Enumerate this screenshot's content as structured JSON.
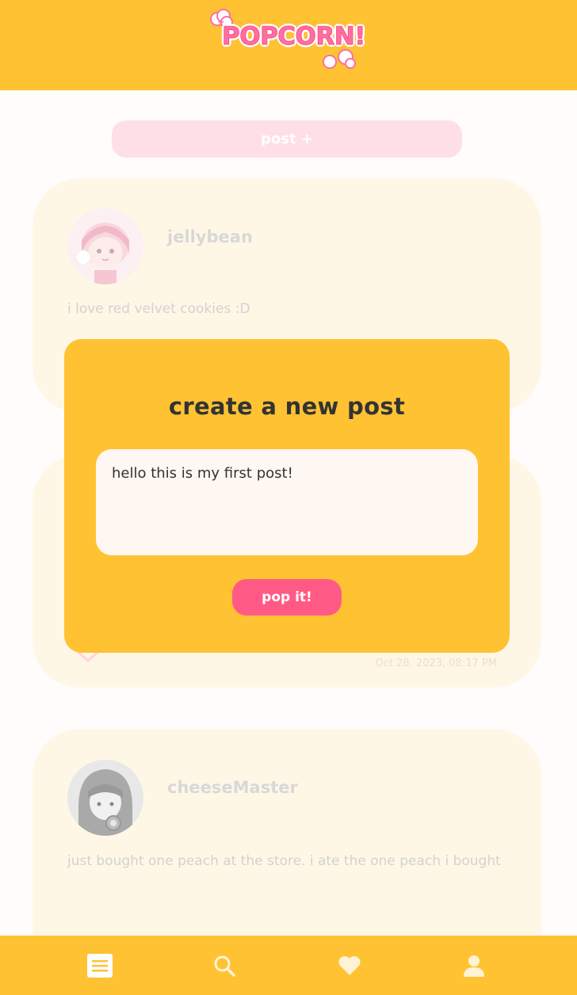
{
  "header": {
    "logo_text": "POPCORN!"
  },
  "feed": {
    "post_button_label": "post +",
    "posts": [
      {
        "username": "jellybean",
        "text": "i love red velvet cookies :D"
      },
      {
        "timestamp": "Oct 28, 2023, 08:17 PM"
      },
      {
        "username": "cheeseMaster",
        "text": "just bought one peach at the store. i ate the one peach i bought"
      }
    ]
  },
  "modal": {
    "title": "create a new post",
    "input_value": "hello this is my first post!",
    "submit_label": "pop it!"
  },
  "nav": {
    "items": [
      "feed-icon",
      "search-icon",
      "heart-icon",
      "profile-icon"
    ]
  },
  "colors": {
    "brand_yellow": "#ffc233",
    "accent_pink": "#ff5a86",
    "card_bg": "#fff7e6",
    "post_button_bg": "#ffdfe6"
  }
}
